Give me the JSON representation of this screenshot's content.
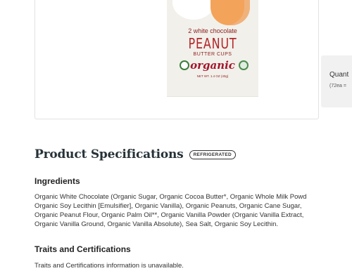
{
  "product_image": {
    "line1": "2 white chocolate",
    "title": "PEANUT",
    "subtitle": "BUTTER CUPS",
    "brand": "organic",
    "net_weight": "NET WT. 1.4 OZ (40g)"
  },
  "quantity": {
    "title": "Quant",
    "sub": "(72ea ="
  },
  "specs": {
    "title": "Product Specifications",
    "badge": "REFRIGERATED",
    "ingredients_heading": "Ingredients",
    "ingredients_lines": [
      "Organic White Chocolate (Organic Sugar, Organic Cocoa Butter*, Organic Whole Milk Powd",
      "Organic Soy Lecithin [Emulsifier], Organic Vanilla), Organic Peanuts, Organic Cane Sugar,",
      "Organic Peanut Flour, Organic Palm Oil**, Organic Vanilla Powder (Organic Vanilla Extract,",
      "Organic Vanilla Ground, Organic Vanilla Absolute), Sea Salt, Organic Soy Lecithin."
    ],
    "traits_heading": "Traits and Certifications",
    "traits_text": "Traits and Certifications information is unavailable."
  }
}
